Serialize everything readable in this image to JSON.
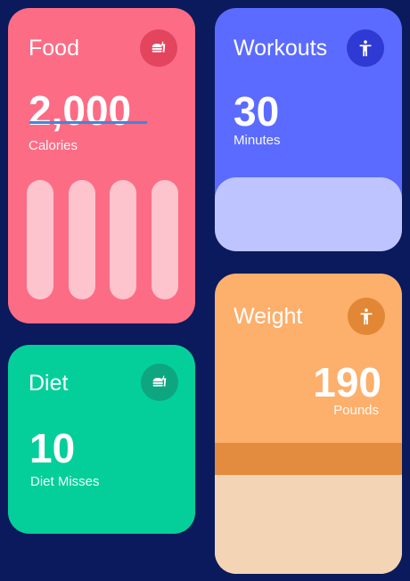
{
  "food": {
    "title": "Food",
    "value": "2,000",
    "unit": "Calories",
    "icon": "burger-drink-icon",
    "bar_count": 4
  },
  "workouts": {
    "title": "Workouts",
    "value": "30",
    "unit": "Minutes",
    "icon": "person-icon"
  },
  "diet": {
    "title": "Diet",
    "value": "10",
    "unit": "Diet Misses",
    "icon": "burger-drink-icon"
  },
  "weight": {
    "title": "Weight",
    "value": "190",
    "unit": "Pounds",
    "icon": "person-icon"
  },
  "colors": {
    "background": "#0a1a5c",
    "food": "#fd6c85",
    "workouts": "#5b6bff",
    "diet": "#04cf9a",
    "weight": "#fdaf6c"
  }
}
